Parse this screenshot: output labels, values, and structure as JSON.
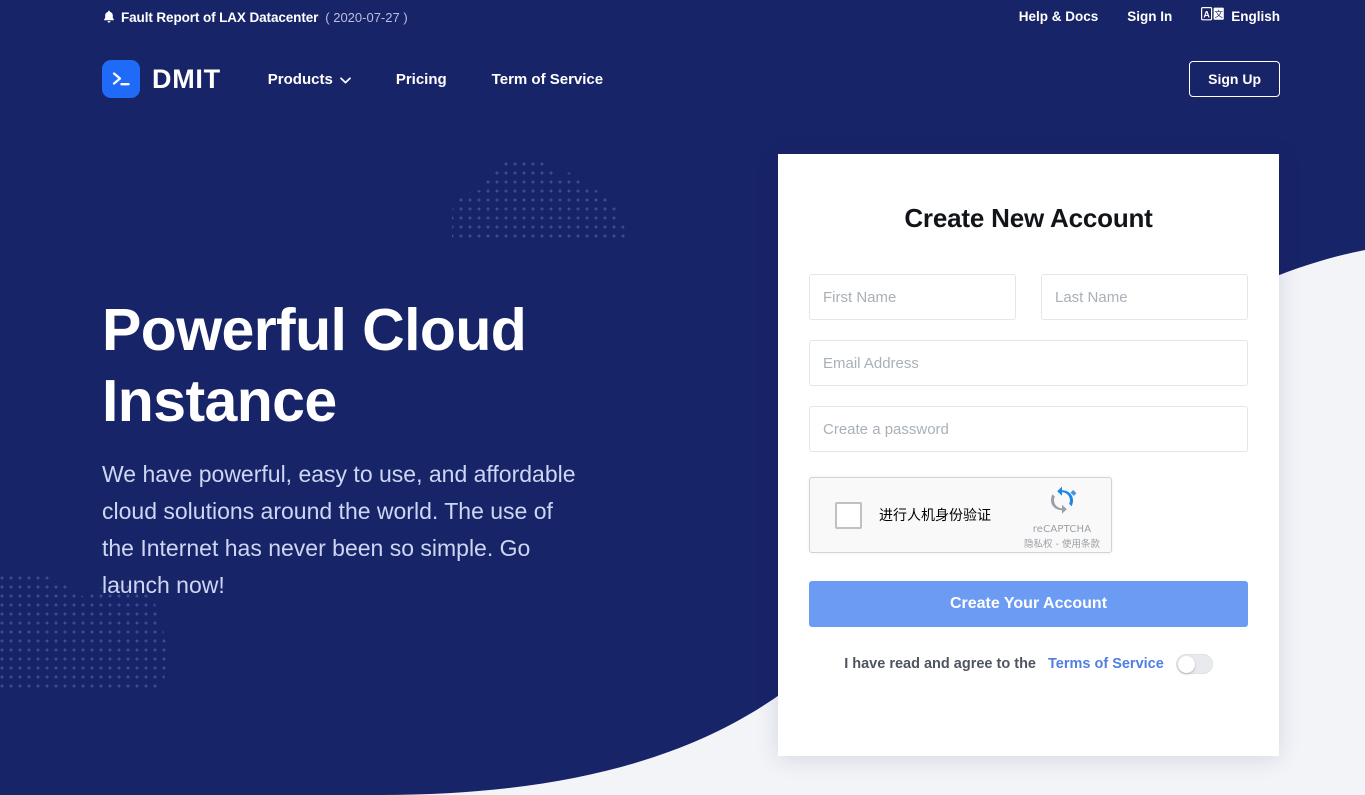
{
  "colors": {
    "navy": "#182468",
    "accent_blue": "#6c9bf4",
    "logo_blue": "#1f6bf7",
    "page_bg": "#f2f4f8",
    "link_blue": "#4f7fe0"
  },
  "topbar": {
    "bell_icon": "bell-icon",
    "fault_title": "Fault Report of LAX Datacenter",
    "fault_date": "( 2020-07-27 )",
    "links": [
      {
        "label": "Help & Docs",
        "name": "help-and-docs-link"
      },
      {
        "label": "Sign In",
        "name": "sign-in-link"
      }
    ],
    "language": {
      "icon": "translate-icon",
      "label": "English"
    }
  },
  "navbar": {
    "brand": {
      "icon": "terminal-prompt-icon",
      "text": "DMIT"
    },
    "links": [
      {
        "label": "Products",
        "has_caret": true
      },
      {
        "label": "Pricing",
        "has_caret": false
      },
      {
        "label": "Term of Service",
        "has_caret": false
      }
    ],
    "signup_label": "Sign Up"
  },
  "hero": {
    "title": "Powerful Cloud Instance",
    "subtitle": "We have powerful, easy to use, and affordable cloud solutions around the world. The use of the Internet has never been so simple. Go launch now!"
  },
  "signup_card": {
    "title": "Create New Account",
    "fields": {
      "first_name": {
        "placeholder": "First Name",
        "value": ""
      },
      "last_name": {
        "placeholder": "Last Name",
        "value": ""
      },
      "email": {
        "placeholder": "Email Address",
        "value": ""
      },
      "password": {
        "placeholder": "Create a password",
        "value": ""
      }
    },
    "recaptcha": {
      "label": "进行人机身份验证",
      "brand_name": "reCAPTCHA",
      "terms": "隐私权 - 使用条款",
      "checked": false,
      "logo_icon": "recaptcha-logo-icon"
    },
    "submit_label": "Create Your Account",
    "agree": {
      "text": "I have read and agree to the",
      "link_label": "Terms of Service",
      "toggle_on": false
    }
  }
}
